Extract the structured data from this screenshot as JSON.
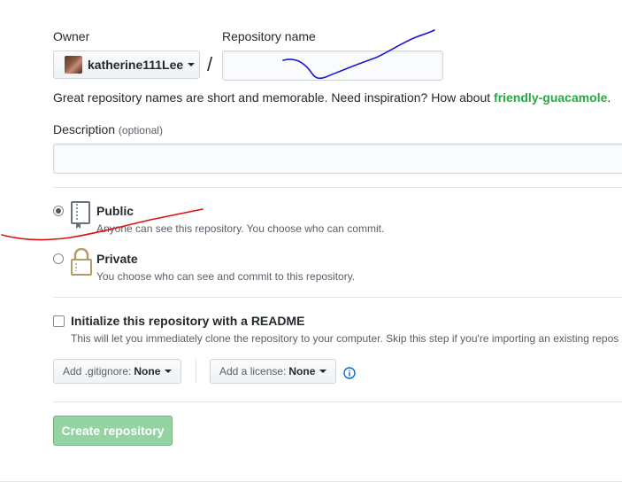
{
  "owner": {
    "label": "Owner",
    "selected": "katherine111Lee"
  },
  "repo_name": {
    "label": "Repository name",
    "value": "",
    "placeholder": ""
  },
  "slash": "/",
  "hint": {
    "prefix": "Great repository names are short and memorable. Need inspiration? How about ",
    "suggestion": "friendly-guacamole",
    "suffix": "."
  },
  "description": {
    "label": "Description",
    "optional": "(optional)",
    "value": ""
  },
  "visibility": {
    "public": {
      "title": "Public",
      "note": "Anyone can see this repository. You choose who can commit.",
      "checked": true,
      "icon": "repo-book-icon"
    },
    "private": {
      "title": "Private",
      "note": "You choose who can see and commit to this repository.",
      "checked": false,
      "icon": "lock-icon"
    }
  },
  "readme": {
    "label": "Initialize this repository with a README",
    "note": "This will let you immediately clone the repository to your computer. Skip this step if you're importing an existing repos",
    "checked": false
  },
  "gitignore": {
    "label": "Add .gitignore:",
    "value": "None"
  },
  "license": {
    "label": "Add a license:",
    "value": "None"
  },
  "create_button": "Create repository",
  "colors": {
    "suggestion_green": "#28a745",
    "create_button_bg": "#94d3a2",
    "blue_annotation": "#1a1acc",
    "red_annotation": "#e01010",
    "info_blue": "#0366d6"
  }
}
